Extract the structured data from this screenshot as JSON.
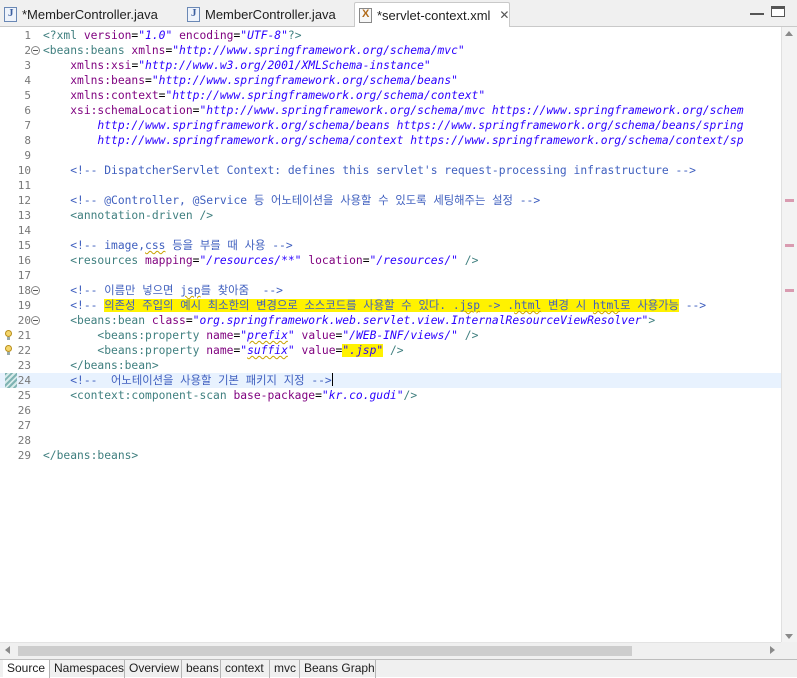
{
  "tabs": [
    {
      "label": "*MemberController.java",
      "icon": "java-file-icon"
    },
    {
      "label": "MemberController.java",
      "icon": "java-file-icon"
    },
    {
      "label": "*servlet-context.xml",
      "icon": "xml-file-icon",
      "close": "✕"
    }
  ],
  "editor": {
    "lines": [
      {
        "n": "1",
        "tokens": [
          [
            "c-tag",
            "<?xml "
          ],
          [
            "c-attr",
            "version"
          ],
          [
            "c-text",
            "="
          ],
          [
            "c-str",
            "\"1.0\""
          ],
          [
            "c-text",
            " "
          ],
          [
            "c-attr",
            "encoding"
          ],
          [
            "c-text",
            "="
          ],
          [
            "c-str",
            "\"UTF-8\""
          ],
          [
            "c-tag",
            "?>"
          ]
        ]
      },
      {
        "n": "2",
        "fold": true,
        "tokens": [
          [
            "c-tag",
            "<beans:beans "
          ],
          [
            "c-attr",
            "xmlns"
          ],
          [
            "c-text",
            "="
          ],
          [
            "c-str",
            "\"http://www.springframework.org/schema/mvc\""
          ]
        ]
      },
      {
        "n": "3",
        "tokens": [
          [
            "c-text",
            "    "
          ],
          [
            "c-attr",
            "xmlns:xsi"
          ],
          [
            "c-text",
            "="
          ],
          [
            "c-str",
            "\"http://www.w3.org/2001/XMLSchema-instance\""
          ]
        ]
      },
      {
        "n": "4",
        "tokens": [
          [
            "c-text",
            "    "
          ],
          [
            "c-attr",
            "xmlns:beans"
          ],
          [
            "c-text",
            "="
          ],
          [
            "c-str",
            "\"http://www.springframework.org/schema/beans\""
          ]
        ]
      },
      {
        "n": "5",
        "tokens": [
          [
            "c-text",
            "    "
          ],
          [
            "c-attr",
            "xmlns:context"
          ],
          [
            "c-text",
            "="
          ],
          [
            "c-str",
            "\"http://www.springframework.org/schema/context\""
          ]
        ]
      },
      {
        "n": "6",
        "tokens": [
          [
            "c-text",
            "    "
          ],
          [
            "c-attr",
            "xsi:schemaLocation"
          ],
          [
            "c-text",
            "="
          ],
          [
            "c-str",
            "\"http://www.springframework.org/schema/mvc https://www.springframework.org/schem"
          ]
        ]
      },
      {
        "n": "7",
        "tokens": [
          [
            "c-str",
            "        http://www.springframework.org/schema/beans https://www.springframework.org/schema/beans/spring"
          ]
        ]
      },
      {
        "n": "8",
        "tokens": [
          [
            "c-str",
            "        http://www.springframework.org/schema/context https://www.springframework.org/schema/context/sp"
          ]
        ]
      },
      {
        "n": "9",
        "tokens": []
      },
      {
        "n": "10",
        "tokens": [
          [
            "c-text",
            "    "
          ],
          [
            "c-comment",
            "<!-- DispatcherServlet Context: defines this servlet's request-processing infrastructure -->"
          ]
        ]
      },
      {
        "n": "11",
        "tokens": []
      },
      {
        "n": "12",
        "ruler": true,
        "tokens": [
          [
            "c-text",
            "    "
          ],
          [
            "c-comment",
            "<!-- @Controller, @Service 등 어노테이션을 사용할 수 있도록 세팅해주는 설정 -->"
          ]
        ]
      },
      {
        "n": "13",
        "tokens": [
          [
            "c-text",
            "    "
          ],
          [
            "c-tag",
            "<annotation-driven />"
          ]
        ]
      },
      {
        "n": "14",
        "tokens": []
      },
      {
        "n": "15",
        "ruler": true,
        "tokens": [
          [
            "c-text",
            "    "
          ],
          [
            "c-comment",
            "<!-- image,"
          ],
          [
            "c-comment squig",
            "css"
          ],
          [
            "c-comment",
            " 등을 부를 때 사용 -->"
          ]
        ]
      },
      {
        "n": "16",
        "tokens": [
          [
            "c-text",
            "    "
          ],
          [
            "c-tag",
            "<resources "
          ],
          [
            "c-attr",
            "mapping"
          ],
          [
            "c-text",
            "="
          ],
          [
            "c-str",
            "\"/resources/**\""
          ],
          [
            "c-text",
            " "
          ],
          [
            "c-attr",
            "location"
          ],
          [
            "c-text",
            "="
          ],
          [
            "c-str",
            "\"/resources/\""
          ],
          [
            "c-tag",
            " />"
          ]
        ]
      },
      {
        "n": "17",
        "tokens": []
      },
      {
        "n": "18",
        "fold": true,
        "ruler": true,
        "tokens": [
          [
            "c-text",
            "    "
          ],
          [
            "c-comment",
            "<!-- 이름만 넣으면 "
          ],
          [
            "c-comment squig",
            "jsp"
          ],
          [
            "c-comment",
            "를 찾아줌  -->"
          ]
        ]
      },
      {
        "n": "19",
        "tokens": [
          [
            "c-text",
            "    "
          ],
          [
            "c-comment",
            "<!-- "
          ],
          [
            "c-comment hl",
            "의존성 주입의 예시 최소한의 변경으로 소스코드를 사용할 수 있다. ."
          ],
          [
            "c-comment hl squig",
            "jsp"
          ],
          [
            "c-comment hl",
            " -> ."
          ],
          [
            "c-comment hl squig",
            "html"
          ],
          [
            "c-comment hl",
            " 변경 시 "
          ],
          [
            "c-comment hl squig",
            "html"
          ],
          [
            "c-comment hl",
            "로 사용가능"
          ],
          [
            "c-comment",
            " -->"
          ]
        ]
      },
      {
        "n": "20",
        "fold": true,
        "tokens": [
          [
            "c-text",
            "    "
          ],
          [
            "c-tag",
            "<beans:bean "
          ],
          [
            "c-attr",
            "class"
          ],
          [
            "c-text",
            "="
          ],
          [
            "c-str",
            "\"org.springframework.web.servlet.view.InternalResourceViewResolver\""
          ],
          [
            "c-tag",
            ">"
          ]
        ]
      },
      {
        "n": "21",
        "warn": true,
        "tokens": [
          [
            "c-text",
            "        "
          ],
          [
            "c-tag",
            "<beans:property "
          ],
          [
            "c-attr",
            "name"
          ],
          [
            "c-text",
            "="
          ],
          [
            "c-str",
            "\""
          ],
          [
            "c-str squig",
            "prefix"
          ],
          [
            "c-str",
            "\""
          ],
          [
            "c-text",
            " "
          ],
          [
            "c-attr",
            "value"
          ],
          [
            "c-text",
            "="
          ],
          [
            "c-str",
            "\"/WEB-INF/views/\""
          ],
          [
            "c-tag",
            " />"
          ]
        ]
      },
      {
        "n": "22",
        "warn": true,
        "tokens": [
          [
            "c-text",
            "        "
          ],
          [
            "c-tag",
            "<beans:property "
          ],
          [
            "c-attr",
            "name"
          ],
          [
            "c-text",
            "="
          ],
          [
            "c-str",
            "\""
          ],
          [
            "c-str squig",
            "suffix"
          ],
          [
            "c-str",
            "\""
          ],
          [
            "c-text",
            " "
          ],
          [
            "c-attr",
            "value"
          ],
          [
            "c-text",
            "="
          ],
          [
            "c-str hl",
            "\".jsp\""
          ],
          [
            "c-tag",
            " />"
          ]
        ]
      },
      {
        "n": "23",
        "tokens": [
          [
            "c-text",
            "    "
          ],
          [
            "c-tag",
            "</beans:bean>"
          ]
        ]
      },
      {
        "n": "24",
        "current": true,
        "change": true,
        "tokens": [
          [
            "c-text",
            "    "
          ],
          [
            "c-comment",
            "<!--  어노테이션을 사용할 기본 패키지 지정 -->"
          ]
        ],
        "cursor": true
      },
      {
        "n": "25",
        "tokens": [
          [
            "c-text",
            "    "
          ],
          [
            "c-tag",
            "<context:component-scan "
          ],
          [
            "c-attr",
            "base-package"
          ],
          [
            "c-text",
            "="
          ],
          [
            "c-str",
            "\"kr.co.gudi\""
          ],
          [
            "c-tag",
            "/>"
          ]
        ]
      },
      {
        "n": "26",
        "tokens": []
      },
      {
        "n": "27",
        "tokens": []
      },
      {
        "n": "28",
        "tokens": []
      },
      {
        "n": "29",
        "tokens": [
          [
            "c-tag",
            "</beans:beans>"
          ]
        ]
      }
    ]
  },
  "bottom_tabs": [
    "Source",
    "Namespaces",
    "Overview",
    "beans",
    "context",
    "mvc",
    "Beans Graph"
  ],
  "colors": {
    "tag": "#3f7f7f",
    "attr": "#7f007f",
    "string": "#2a00ff",
    "comment": "#3f5fbf",
    "highlight": "#fff200"
  }
}
